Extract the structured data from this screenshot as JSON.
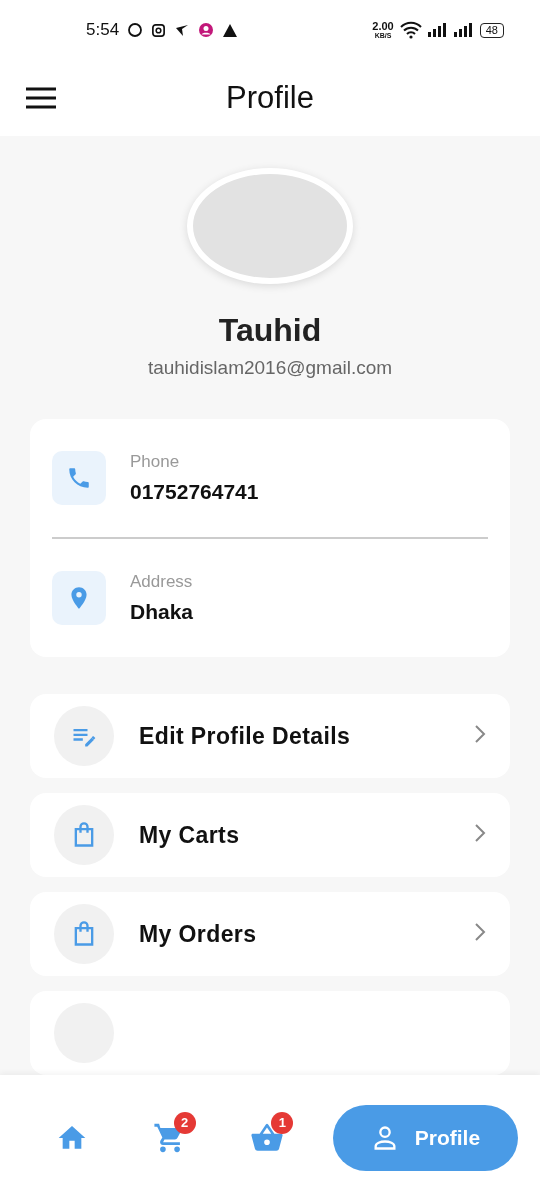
{
  "status_bar": {
    "time": "5:54",
    "speed": "2.00",
    "speed_unit": "KB/S",
    "battery": "48"
  },
  "app_bar": {
    "title": "Profile"
  },
  "profile": {
    "name": "Tauhid",
    "email": "tauhidislam2016@gmail.com"
  },
  "info": [
    {
      "kind": "phone",
      "label": "Phone",
      "value": "01752764741"
    },
    {
      "kind": "address",
      "label": "Address",
      "value": "Dhaka"
    }
  ],
  "menu": [
    {
      "kind": "edit",
      "label": "Edit Profile Details"
    },
    {
      "kind": "bag",
      "label": "My Carts"
    },
    {
      "kind": "bag",
      "label": "My Orders"
    }
  ],
  "bottom_nav": [
    {
      "kind": "home",
      "selected": false
    },
    {
      "kind": "cart",
      "badge": "2",
      "selected": false
    },
    {
      "kind": "basket",
      "badge": "1",
      "selected": false
    },
    {
      "kind": "profile",
      "label": "Profile",
      "selected": true
    }
  ]
}
